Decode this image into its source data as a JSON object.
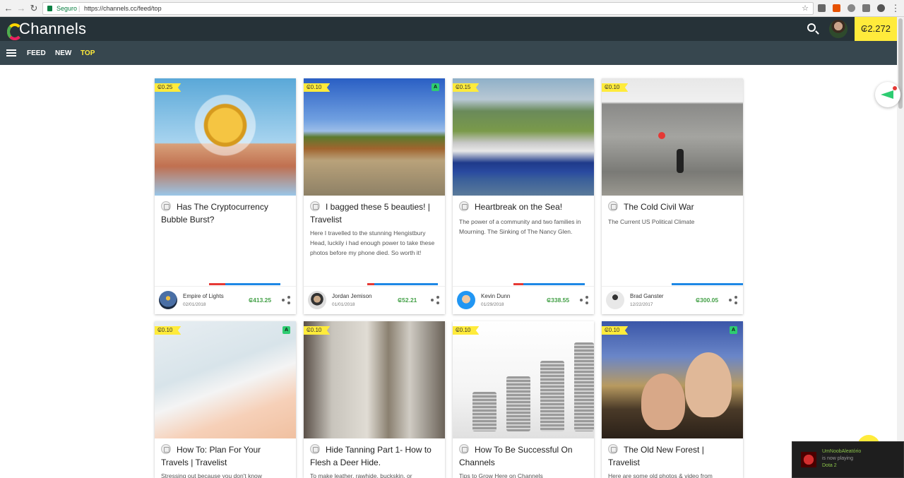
{
  "browser": {
    "security_label": "Seguro",
    "url": "https://channels.cc/feed/top"
  },
  "header": {
    "logo_text": "Channels",
    "balance": "₢2.272"
  },
  "nav": {
    "tabs": [
      {
        "label": "FEED"
      },
      {
        "label": "NEW"
      },
      {
        "label": "TOP"
      }
    ]
  },
  "cards": [
    {
      "price": "₢0.25",
      "title": "Has The Cryptocurrency Bubble Burst?",
      "description": "",
      "author": "Empire of Lights",
      "date": "02/01/2018",
      "amount": "₢413.25",
      "has_a_badge": false
    },
    {
      "price": "₢0.10",
      "title": "I bagged these 5 beauties! | Travelist",
      "description": "Here I travelled to the stunning Hengistbury Head, luckily i had enough power to take these photos before my phone died. So worth it!",
      "author": "Jordan Jemison",
      "date": "01/01/2018",
      "amount": "₢52.21",
      "has_a_badge": true
    },
    {
      "price": "₢0.15",
      "title": "Heartbreak on the Sea!",
      "description": "The power of a community and two families in Mourning. The Sinking of The Nancy Glen.",
      "author": "Kevin Dunn",
      "date": "01/29/2018",
      "amount": "₢338.55",
      "has_a_badge": false
    },
    {
      "price": "₢0.10",
      "title": "The Cold Civil War",
      "description": "The Current US Political Climate",
      "author": "Brad Ganster",
      "date": "12/22/2017",
      "amount": "₢300.05",
      "has_a_badge": false
    },
    {
      "price": "₢0.10",
      "title": "How To: Plan For Your Travels | Travelist",
      "description": "Stressing out because you don't know",
      "has_a_badge": true
    },
    {
      "price": "₢0.10",
      "title": "Hide Tanning Part 1- How to Flesh a Deer Hide.",
      "description": "To make leather, rawhide, buckskin, or",
      "has_a_badge": false
    },
    {
      "price": "₢0.10",
      "title": "How To Be Successful On Channels",
      "description": "Tips to Grow Here on Channels",
      "has_a_badge": false
    },
    {
      "price": "₢0.10",
      "title": "The Old New Forest | Travelist",
      "description": "Here are some old photos & video from",
      "has_a_badge": true
    }
  ],
  "badge_letter": "A",
  "toast": {
    "user": "UmNoobAleatório",
    "status": "is now playing",
    "game": "Dota 2"
  }
}
